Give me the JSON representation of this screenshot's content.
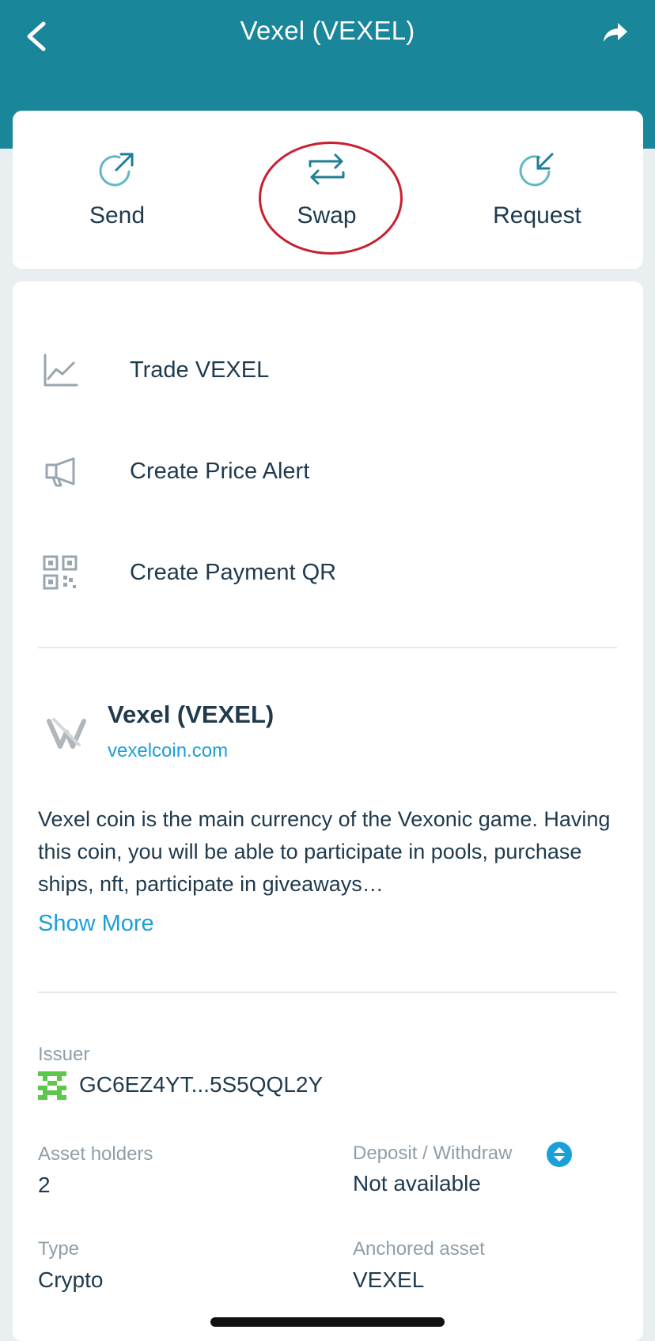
{
  "header": {
    "title": "Vexel (VEXEL)",
    "back_icon": "chevron-left-icon",
    "share_icon": "share-arrow-icon",
    "background": "#1a869a"
  },
  "actions": [
    {
      "label": "Send",
      "icon": "send-arrow-icon"
    },
    {
      "label": "Swap",
      "icon": "swap-arrows-icon"
    },
    {
      "label": "Request",
      "icon": "request-arrow-icon"
    }
  ],
  "highlight": {
    "target": "Swap",
    "color": "#c8202f"
  },
  "menu": [
    {
      "label": "Trade VEXEL",
      "icon": "chart-line-icon"
    },
    {
      "label": "Create Price Alert",
      "icon": "megaphone-icon"
    },
    {
      "label": "Create Payment QR",
      "icon": "qr-code-icon"
    }
  ],
  "asset": {
    "name": "Vexel (VEXEL)",
    "domain": "vexelcoin.com",
    "description": "Vexel coin is the main currency of the Vexonic game. Having this coin, you will be able to participate in pools, purchase ships, nft, participate in giveaways…",
    "show_more": "Show More"
  },
  "details": {
    "issuer_label": "Issuer",
    "issuer_value": "GC6EZ4YT...5S5QQL2Y",
    "holders_label": "Asset holders",
    "holders_value": "2",
    "deposit_label": "Deposit / Withdraw",
    "deposit_value": "Not available",
    "type_label": "Type",
    "type_value": "Crypto",
    "anchored_label": "Anchored asset",
    "anchored_value": "VEXEL"
  },
  "colors": {
    "accent": "#1a9fd9",
    "text": "#1f3a4d",
    "muted": "#8f9ea8",
    "icon_teal": "#5fb8c7"
  }
}
